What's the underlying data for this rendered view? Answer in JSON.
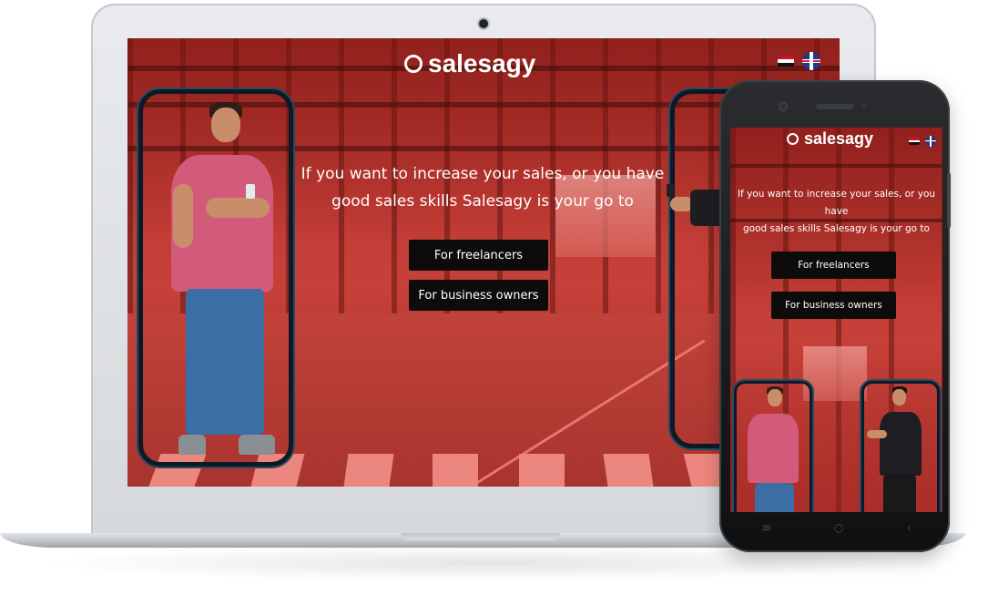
{
  "brand": {
    "name": "salesagy"
  },
  "hero": {
    "line1": "If you want to increase your sales, or you have",
    "line2": "good sales skills Salesagy is your go to"
  },
  "buttons": {
    "freelancers": "For freelancers",
    "business_owners": "For business owners"
  },
  "languages": [
    {
      "icon": "egypt-flag-icon"
    },
    {
      "icon": "uk-flag-icon"
    }
  ],
  "phone_nav": {
    "menu": "≡",
    "home": "○",
    "back": "‹"
  },
  "colors": {
    "overlay_red": "#c9473f",
    "button_bg": "#0e0b0b",
    "text": "#ffffff",
    "shirt_pink": "#d25a7b"
  }
}
